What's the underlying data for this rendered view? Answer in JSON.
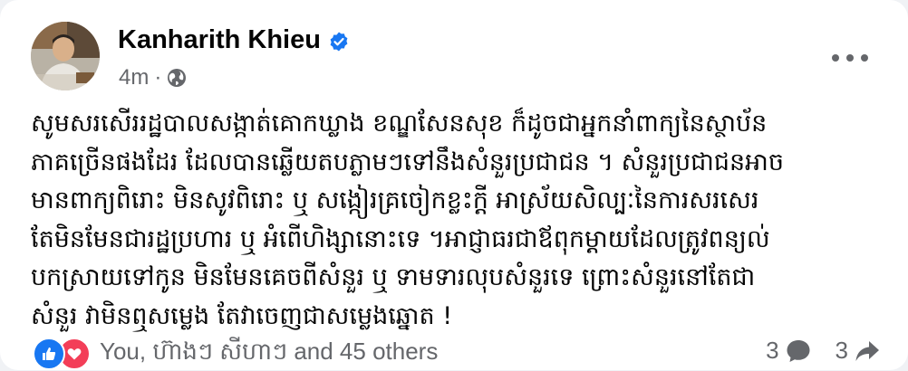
{
  "post": {
    "author": "Kanharith Khieu",
    "timestamp": "4m",
    "separator": "·",
    "privacy_icon": "globe-icon",
    "lines": [
      "សូមសរសើររដ្ឋបាលសង្កាត់គោកឃ្លាង ខណ្ឌសែនសុខ ក៏ដូចជាអ្នកនាំពាក្យនៃស្ថាប័ន",
      "ភាគច្រើនផងដែរ ដែលបានឆ្លើយតបភ្លាមៗទៅនឹងសំនួរប្រជាជន ។ សំនួរប្រជាជនអាច",
      "មានពាក្យពិរោះ មិនសូវពិរោះ ឬ សង្កៀរគ្រចៀកខ្លះក្តី អាស្រ័យសិល្បៈនៃការសរសេរ",
      "តែមិនមែនជារដ្ឋប្រហារ ឬ អំពើហិង្សានោះទេ ។អាជ្ញាធរជាឪពុកម្តាយដែលត្រូវពន្យល់",
      "បកស្រាយទៅកូន មិនមែនគេចពីសំនួរ ឬ ទាមទារលុបសំនួរទេ ព្រោះសំនួរនៅតែជា",
      "សំនួរ វាមិនឮសម្លេង តែវាចេញជាសម្លេងឆ្នោត !"
    ]
  },
  "reactions": {
    "icons": [
      "like-icon",
      "love-icon"
    ],
    "text": "You, ហ៊ាងៗ សីហាៗ and 45 others"
  },
  "stats": {
    "comments": "3",
    "shares": "3"
  },
  "colors": {
    "like": "#1877f2",
    "love": "#f33e58",
    "secondary_text": "#65676b",
    "primary_text": "#050505"
  }
}
